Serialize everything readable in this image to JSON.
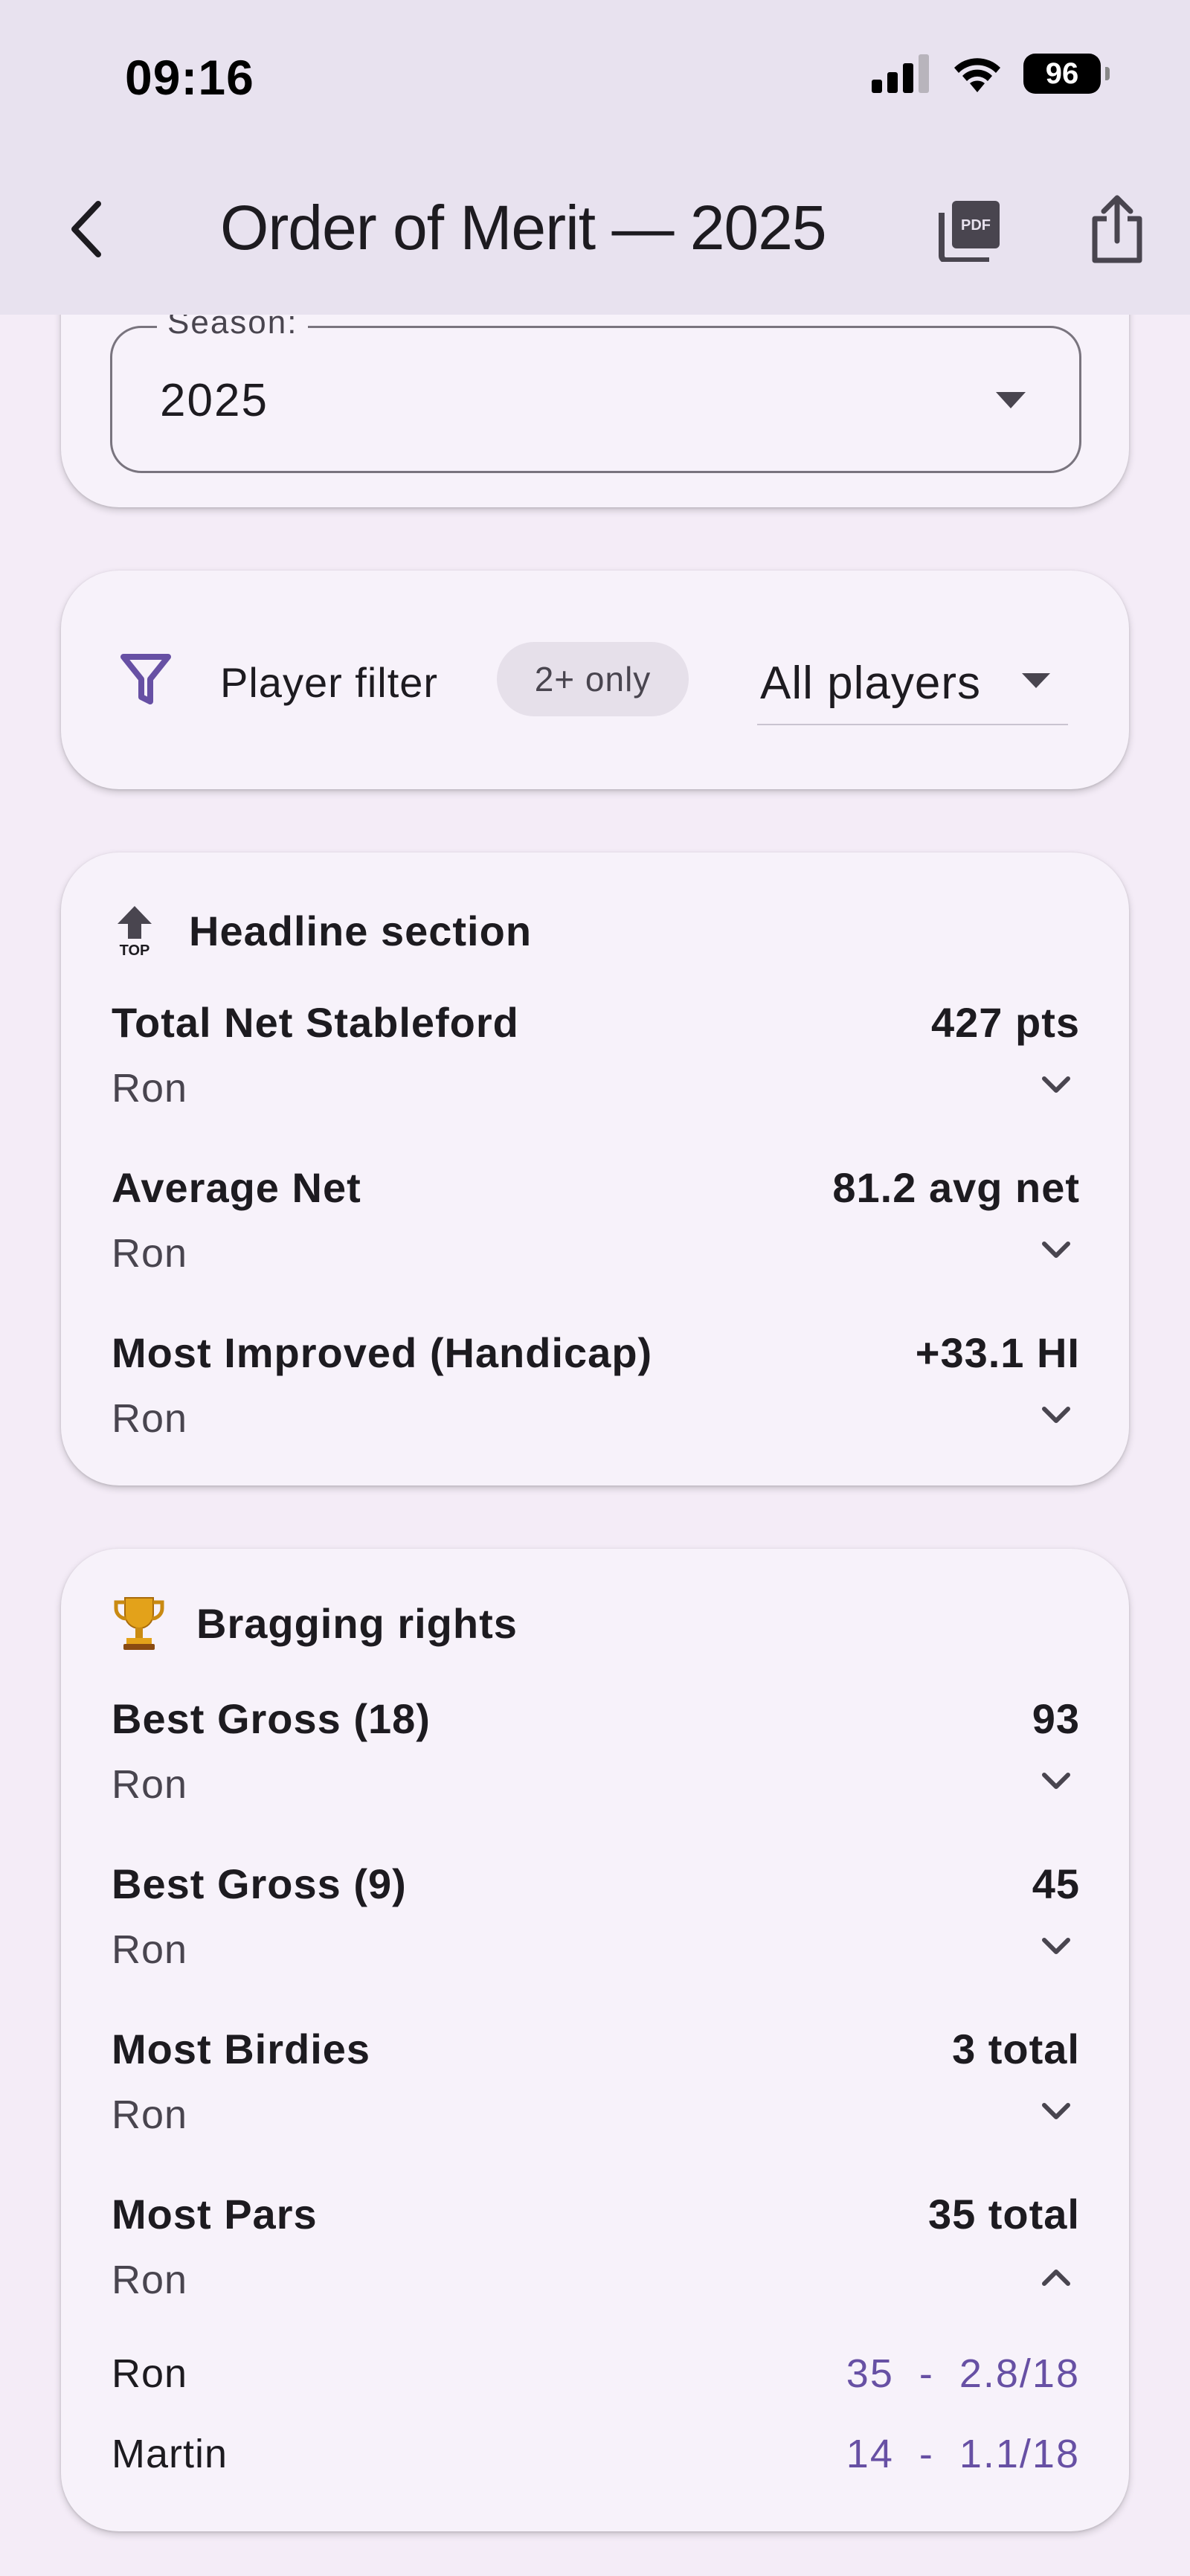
{
  "status_bar": {
    "time": "09:16",
    "battery": "96"
  },
  "app_bar": {
    "title": "Order of Merit — 2025",
    "icons": [
      "back-arrow-icon",
      "pdf-icon",
      "share-icon"
    ]
  },
  "season": {
    "label": "Season:",
    "value": "2025"
  },
  "filter": {
    "label": "Player filter",
    "chip": "2+ only",
    "select_value": "All players"
  },
  "headline": {
    "title": "Headline section",
    "icon": "top-arrow-icon",
    "icon_text": "TOP",
    "rows": [
      {
        "label": "Total Net Stableford",
        "value": "427 pts",
        "player": "Ron"
      },
      {
        "label": "Average Net",
        "value": "81.2 avg net",
        "player": "Ron"
      },
      {
        "label": "Most Improved (Handicap)",
        "value": "+33.1 HI",
        "player": "Ron"
      }
    ]
  },
  "bragging": {
    "title": "Bragging rights",
    "icon": "trophy-icon",
    "rows": [
      {
        "label": "Best Gross (18)",
        "value": "93",
        "player": "Ron"
      },
      {
        "label": "Best Gross (9)",
        "value": "45",
        "player": "Ron"
      },
      {
        "label": "Most Birdies",
        "value": "3 total",
        "player": "Ron"
      },
      {
        "label": "Most Pars",
        "value": "35 total",
        "player": "Ron"
      }
    ],
    "details": [
      {
        "name": "Ron",
        "value": "35  -  2.8/18"
      },
      {
        "name": "Martin",
        "value": "14  -  1.1/18"
      }
    ]
  },
  "colors": {
    "accent": "#6750a4",
    "app_bar": "#e8e2ef",
    "background": "#f4ecf7",
    "card": "#f7f2fa"
  }
}
